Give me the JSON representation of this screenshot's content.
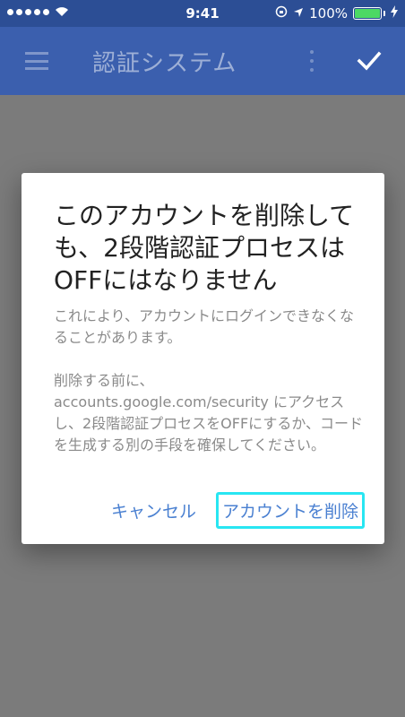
{
  "status_bar": {
    "time": "9:41",
    "battery_percent": "100%",
    "icons": [
      "signal-dots-icon",
      "wifi-icon",
      "rotation-lock-icon",
      "location-icon",
      "battery-icon",
      "charging-icon"
    ]
  },
  "app_bar": {
    "title": "認証システム",
    "icons": [
      "menu-icon",
      "overflow-icon",
      "check-icon"
    ]
  },
  "dialog": {
    "title": "このアカウントを削除しても、2段階認証プロセスはOFFにはなりません",
    "body_paragraph_1": "これにより、アカウントにログインできなくなることがあります。",
    "body_paragraph_2": "削除する前に、accounts.google.com/security にアクセスし、2段階認証プロセスをOFFにするか、コードを生成する別の手段を確保してください。",
    "cancel_label": "キャンセル",
    "confirm_label": "アカウントを削除"
  },
  "colors": {
    "status_bar": "#2c4e95",
    "app_bar": "#3b5fae",
    "scrim": "#7b7b7b",
    "button_text": "#4a80d1",
    "focus_outline": "#28e6f2",
    "battery_fill": "#4cd964"
  }
}
